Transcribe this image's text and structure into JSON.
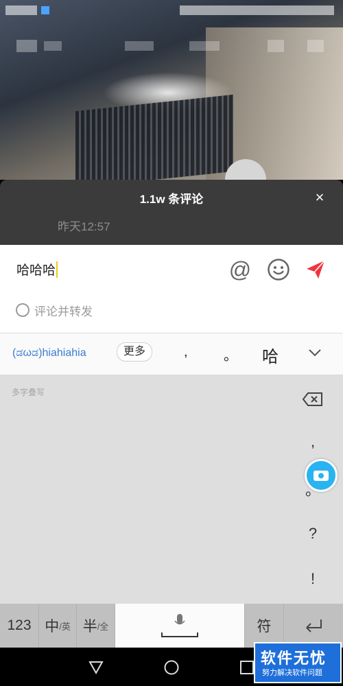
{
  "comments": {
    "title": "1.1w 条评论",
    "close_label": "×",
    "time_label": "昨天12:57"
  },
  "input": {
    "value": "哈哈哈",
    "repost_label": "评论并转发",
    "at_label": "@"
  },
  "candidates": {
    "pinyin": "(ಡωಡ)hiahiahia",
    "more_label": "更多",
    "items": [
      ",",
      "。",
      "哈"
    ]
  },
  "keyboard": {
    "hint": "多字叠写",
    "side_keys": [
      ",",
      "。",
      "?",
      "!"
    ],
    "keys": {
      "num": "123",
      "lang_main": "中",
      "lang_sub": "/英",
      "width_main": "半",
      "width_sub": "/全",
      "symbol": "符"
    }
  },
  "watermark": {
    "title": "软件无忧",
    "subtitle": "努力解决软件问题"
  },
  "colors": {
    "accent_send": "#f0353f",
    "pinyin_blue": "#3a7bd5",
    "float_button": "#29b3f0"
  }
}
